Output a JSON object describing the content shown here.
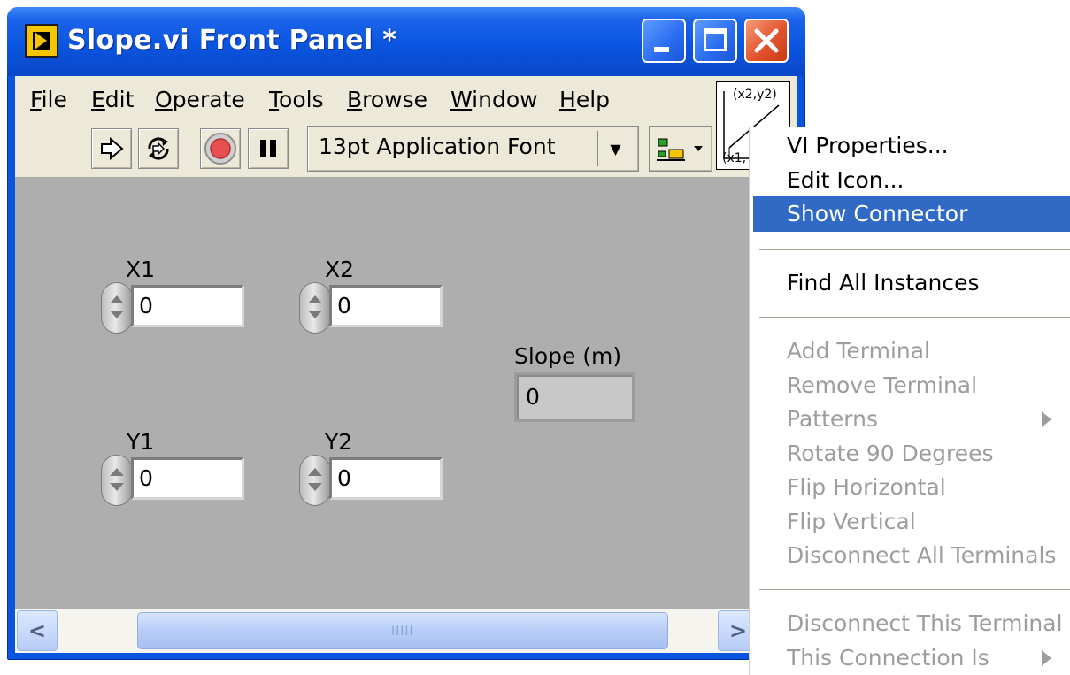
{
  "window": {
    "title": "Slope.vi Front Panel *"
  },
  "menubar": {
    "items": [
      "File",
      "Edit",
      "Operate",
      "Tools",
      "Browse",
      "Window",
      "Help"
    ],
    "accelerators": [
      "F",
      "E",
      "O",
      "T",
      "B",
      "W",
      "H"
    ]
  },
  "toolbar": {
    "font_select": "13pt Application Font",
    "run_icon": "run-arrow-icon",
    "run_continuous_icon": "run-continuously-icon",
    "abort_icon": "abort-icon",
    "pause_icon": "pause-icon",
    "align_icon": "align-objects-icon"
  },
  "vi_icon": {
    "top_label": "(x2,y2)",
    "bottom_label": "(x1,"
  },
  "panel": {
    "controls": [
      {
        "label": "X1",
        "value": "0"
      },
      {
        "label": "X2",
        "value": "0"
      },
      {
        "label": "Y1",
        "value": "0"
      },
      {
        "label": "Y2",
        "value": "0"
      }
    ],
    "indicator": {
      "label": "Slope (m)",
      "value": "0"
    }
  },
  "scrollbar": {
    "grip": "IIIII"
  },
  "context_menu": {
    "groups": [
      [
        {
          "label": "VI Properties...",
          "enabled": true
        },
        {
          "label": "Edit Icon...",
          "enabled": true
        },
        {
          "label": "Show Connector",
          "enabled": true,
          "selected": true
        }
      ],
      [
        {
          "label": "Find All Instances",
          "enabled": true
        }
      ],
      [
        {
          "label": "Add Terminal",
          "enabled": false
        },
        {
          "label": "Remove Terminal",
          "enabled": false
        },
        {
          "label": "Patterns",
          "enabled": false,
          "submenu": true
        },
        {
          "label": "Rotate 90 Degrees",
          "enabled": false
        },
        {
          "label": "Flip Horizontal",
          "enabled": false
        },
        {
          "label": "Flip Vertical",
          "enabled": false
        },
        {
          "label": "Disconnect All Terminals",
          "enabled": false
        }
      ],
      [
        {
          "label": "Disconnect This Terminal",
          "enabled": false
        },
        {
          "label": "This Connection Is",
          "enabled": false,
          "submenu": true
        }
      ]
    ]
  }
}
